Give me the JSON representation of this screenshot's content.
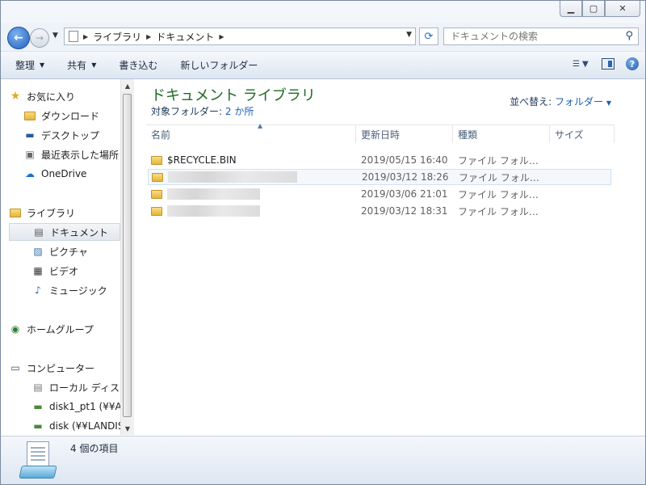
{
  "window": {
    "minimize_icon": "minimize-icon",
    "maximize_icon": "maximize-icon",
    "close_icon": "close-icon"
  },
  "navigation": {
    "breadcrumb": [
      "ライブラリ",
      "ドキュメント"
    ],
    "search_placeholder": "ドキュメントの検索"
  },
  "toolbar": {
    "organize": "整理",
    "share": "共有",
    "burn": "書き込む",
    "new_folder": "新しいフォルダー"
  },
  "sidebar": {
    "favorites": {
      "label": "お気に入り",
      "items": [
        "ダウンロード",
        "デスクトップ",
        "最近表示した場所",
        "OneDrive"
      ]
    },
    "libraries": {
      "label": "ライブラリ",
      "items": [
        "ドキュメント",
        "ピクチャ",
        "ビデオ",
        "ミュージック"
      ]
    },
    "homegroup": "ホームグループ",
    "computer": {
      "label": "コンピューター",
      "items": [
        "ローカル ディスク",
        "disk1_pt1 (¥¥AN",
        "disk (¥¥LANDISK"
      ]
    }
  },
  "library": {
    "title": "ドキュメント ライブラリ",
    "target_label": "対象フォルダー:",
    "target_count": "2 か所",
    "arrange_label": "並べ替え:",
    "arrange_value": "フォルダー"
  },
  "columns": {
    "name": "名前",
    "date": "更新日時",
    "type": "種類",
    "size": "サイズ"
  },
  "files": [
    {
      "name": "$RECYCLE.BIN",
      "date": "2019/05/15 16:40",
      "type": "ファイル フォル…",
      "redacted": false
    },
    {
      "name": "",
      "date": "2019/03/12 18:26",
      "type": "ファイル フォル…",
      "redacted": true
    },
    {
      "name": "",
      "date": "2019/03/06 21:01",
      "type": "ファイル フォル…",
      "redacted": true
    },
    {
      "name": "",
      "date": "2019/03/12 18:31",
      "type": "ファイル フォル…",
      "redacted": true
    }
  ],
  "status": {
    "item_count": "4 個の項目"
  },
  "colors": {
    "library_title": "#1e6a24",
    "link_blue": "#1a5fb4",
    "toolbar_top": "#f5f8fc",
    "toolbar_bottom": "#dde6f1"
  }
}
